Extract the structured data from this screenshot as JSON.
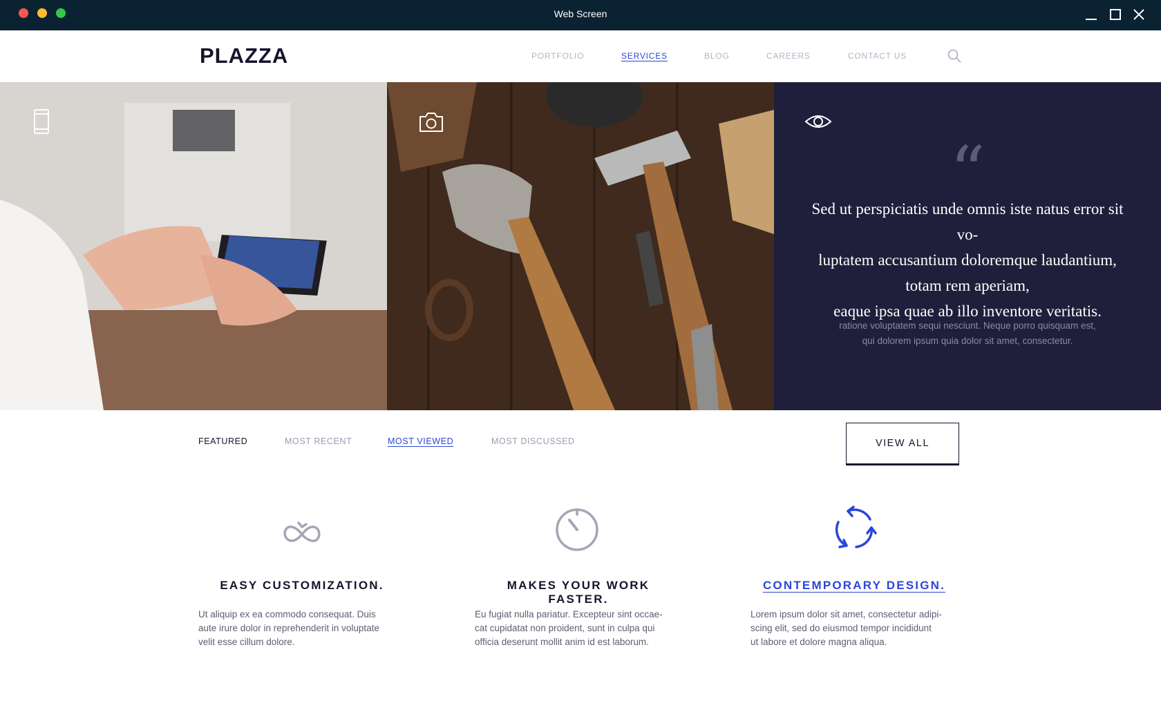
{
  "window": {
    "title": "Web Screen"
  },
  "site": {
    "logo": "PLAZZA",
    "nav": [
      {
        "label": "PORTFOLIO",
        "active": false
      },
      {
        "label": "SERVICES",
        "active": true
      },
      {
        "label": "BLOG",
        "active": false
      },
      {
        "label": "CAREERS",
        "active": false
      },
      {
        "label": "CONTACT US",
        "active": false
      }
    ],
    "search_icon": "search-icon"
  },
  "hero": {
    "panels": [
      {
        "icon": "phone-icon",
        "image": "woman holding smartphone"
      },
      {
        "icon": "camera-icon",
        "image": "hand tools on wooden table"
      },
      {
        "icon": "eye-icon"
      }
    ],
    "quote_mark": "“",
    "quote_lines": [
      "Sed ut perspiciatis unde omnis iste natus error sit vo-",
      "luptatem accusantium doloremque laudantium,",
      "totam rem aperiam,",
      "eaque ipsa quae ab illo inventore veritatis."
    ],
    "quote_sub_lines": [
      "ratione voluptatem sequi nesciunt. Neque porro quisquam est,",
      "qui dolorem ipsum quia dolor sit amet, consectetur."
    ]
  },
  "filters": {
    "tabs": [
      {
        "label": "FEATURED"
      },
      {
        "label": "MOST RECENT"
      },
      {
        "label": "MOST VIEWED",
        "active": true
      },
      {
        "label": "MOST DISCUSSED"
      }
    ],
    "view_all": "VIEW ALL"
  },
  "features": [
    {
      "icon": "infinity-icon",
      "title": "EASY CUSTOMIZATION.",
      "desc_lines": [
        "Ut aliquip ex ea commodo consequat. Duis",
        "aute irure dolor in reprehenderit in voluptate",
        "velit esse cillum dolore."
      ]
    },
    {
      "icon": "timer-icon",
      "title": "MAKES YOUR WORK FASTER.",
      "desc_lines": [
        "Eu fugiat nulla pariatur. Excepteur sint occae-",
        "cat cupidatat non proident, sunt in culpa qui",
        "officia deserunt mollit anim id est laborum."
      ]
    },
    {
      "icon": "refresh-icon",
      "title": "CONTEMPORARY DESIGN.",
      "active": true,
      "desc_lines": [
        "Lorem ipsum dolor sit amet, consectetur adipi-",
        "scing elit, sed do eiusmod tempor incididunt",
        "ut labore et dolore magna aliqua."
      ]
    }
  ],
  "colors": {
    "accent": "#2a46d8",
    "dark": "#14142b",
    "quote_bg": "#1f1f3b",
    "titlebar": "#0b2233"
  }
}
